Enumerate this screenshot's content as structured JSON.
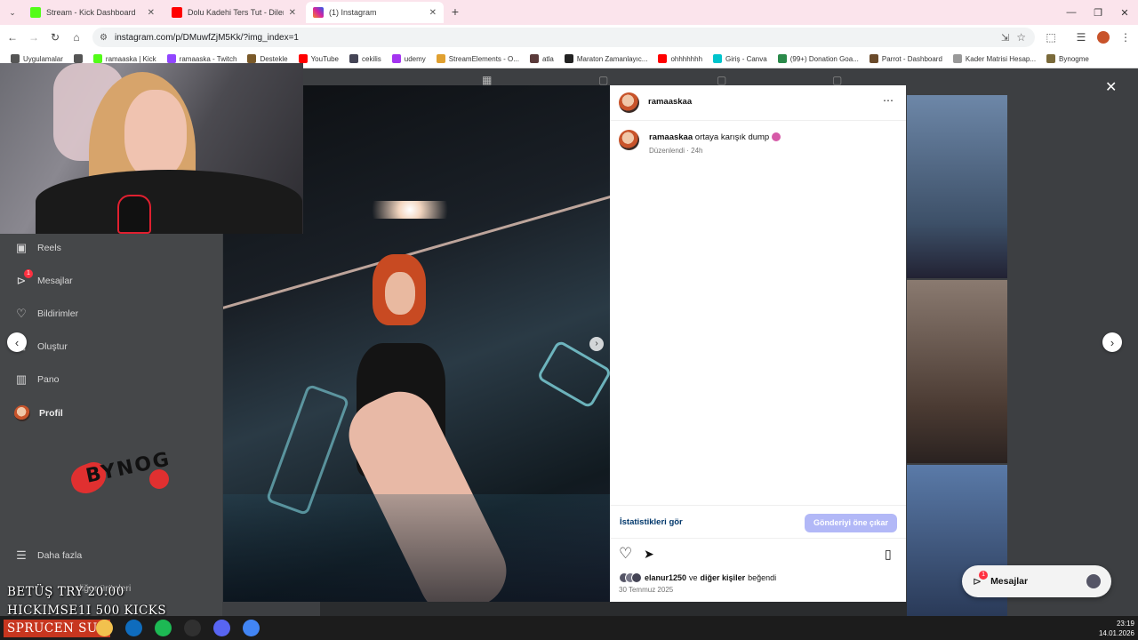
{
  "browser": {
    "tabs": [
      {
        "title": "Stream - Kick Dashboard",
        "icon": "kick-icon",
        "color": "#53fc18"
      },
      {
        "title": "Dolu Kadehi Ters Tut - Dilerim K",
        "icon": "youtube-icon",
        "color": "#ff0000"
      },
      {
        "title": "(1) Instagram",
        "icon": "instagram-icon",
        "color": "#d6249f"
      }
    ],
    "new_tab": "+",
    "url": "instagram.com/p/DMuwfZjM5Kk/?img_index=1",
    "bookmarks": [
      {
        "label": "Uygulamalar",
        "icon": "apps-icon",
        "color": "#555"
      },
      {
        "label": "",
        "icon": "grid-icon",
        "color": "#555"
      },
      {
        "label": "ramaaska | Kick",
        "icon": "kick-icon",
        "color": "#53fc18"
      },
      {
        "label": "ramaaska - Twitch",
        "icon": "twitch-icon",
        "color": "#9146ff"
      },
      {
        "label": "Destekle",
        "icon": "support-icon",
        "color": "#7a5a2a"
      },
      {
        "label": "YouTube",
        "icon": "youtube-icon",
        "color": "#ff0000"
      },
      {
        "label": "cekilis",
        "icon": "bot-icon",
        "color": "#445"
      },
      {
        "label": "udemy",
        "icon": "udemy-icon",
        "color": "#a435f0"
      },
      {
        "label": "StreamElements - O...",
        "icon": "streamelements-icon",
        "color": "#e0a030"
      },
      {
        "label": "atla",
        "icon": "cat-icon",
        "color": "#5a3a3a"
      },
      {
        "label": "Maraton Zamanlayıc...",
        "icon": "timer-icon",
        "color": "#222"
      },
      {
        "label": "ohhhhhhh",
        "icon": "youtube-icon",
        "color": "#ff0000"
      },
      {
        "label": "Giriş - Canva",
        "icon": "canva-icon",
        "color": "#00c4cc"
      },
      {
        "label": "(99+) Donation Goa...",
        "icon": "donation-icon",
        "color": "#2a8a4a"
      },
      {
        "label": "Parrot - Dashboard",
        "icon": "parrot-icon",
        "color": "#6a4a2a"
      },
      {
        "label": "Kader Matrisi Hesap...",
        "icon": "matrix-icon",
        "color": "#999"
      },
      {
        "label": "Bynogme",
        "icon": "bynog-icon",
        "color": "#7a6a3a"
      }
    ]
  },
  "sidebar": {
    "items": [
      {
        "label": "Reels",
        "icon": "reels-icon"
      },
      {
        "label": "Mesajlar",
        "icon": "messages-icon",
        "badge": "1"
      },
      {
        "label": "Bildirimler",
        "icon": "heart-icon"
      },
      {
        "label": "Oluştur",
        "icon": "create-icon"
      },
      {
        "label": "Pano",
        "icon": "dashboard-icon"
      },
      {
        "label": "Profil",
        "icon": "profile-avatar"
      }
    ],
    "more": "Daha fazla",
    "partial": "diğer ürünleri",
    "logo_text": "BYNOG"
  },
  "post": {
    "username": "ramaaskaa",
    "caption_user": "ramaaskaa",
    "caption_text": "ortaya karışık dump",
    "edited": "Düzenlendi · 24h",
    "stats_link": "İstatistikleri gör",
    "boost_button": "Gönderiyi öne çıkar",
    "liked_by_user": "elanur1250",
    "liked_by_mid": "ve",
    "liked_by_others": "diğer kişiler",
    "liked_by_end": "beğendi",
    "date": "30 Temmuz 2025"
  },
  "messages_pill": {
    "label": "Mesajlar",
    "badge": "1"
  },
  "overlay": {
    "line1": "BETÜŞ TRY 20.00",
    "line2": "HICKIMSE1I 500 KICKS",
    "line3": "SPRUCEN SUB"
  },
  "taskbar": {
    "time": "23:19",
    "date": "14.01.2026",
    "apps": [
      {
        "icon": "file-explorer-icon",
        "color": "#f2c14e"
      },
      {
        "icon": "outlook-icon",
        "color": "#0f6cbd"
      },
      {
        "icon": "spotify-icon",
        "color": "#1db954"
      },
      {
        "icon": "obs-icon",
        "color": "#303030"
      },
      {
        "icon": "discord-icon",
        "color": "#5865f2"
      },
      {
        "icon": "chrome-icon",
        "color": "#4285f4"
      }
    ]
  },
  "colors": {
    "boost_button": "#b2b8f7",
    "link_blue": "#0095f6",
    "tab_strip": "#fbe4ec"
  }
}
